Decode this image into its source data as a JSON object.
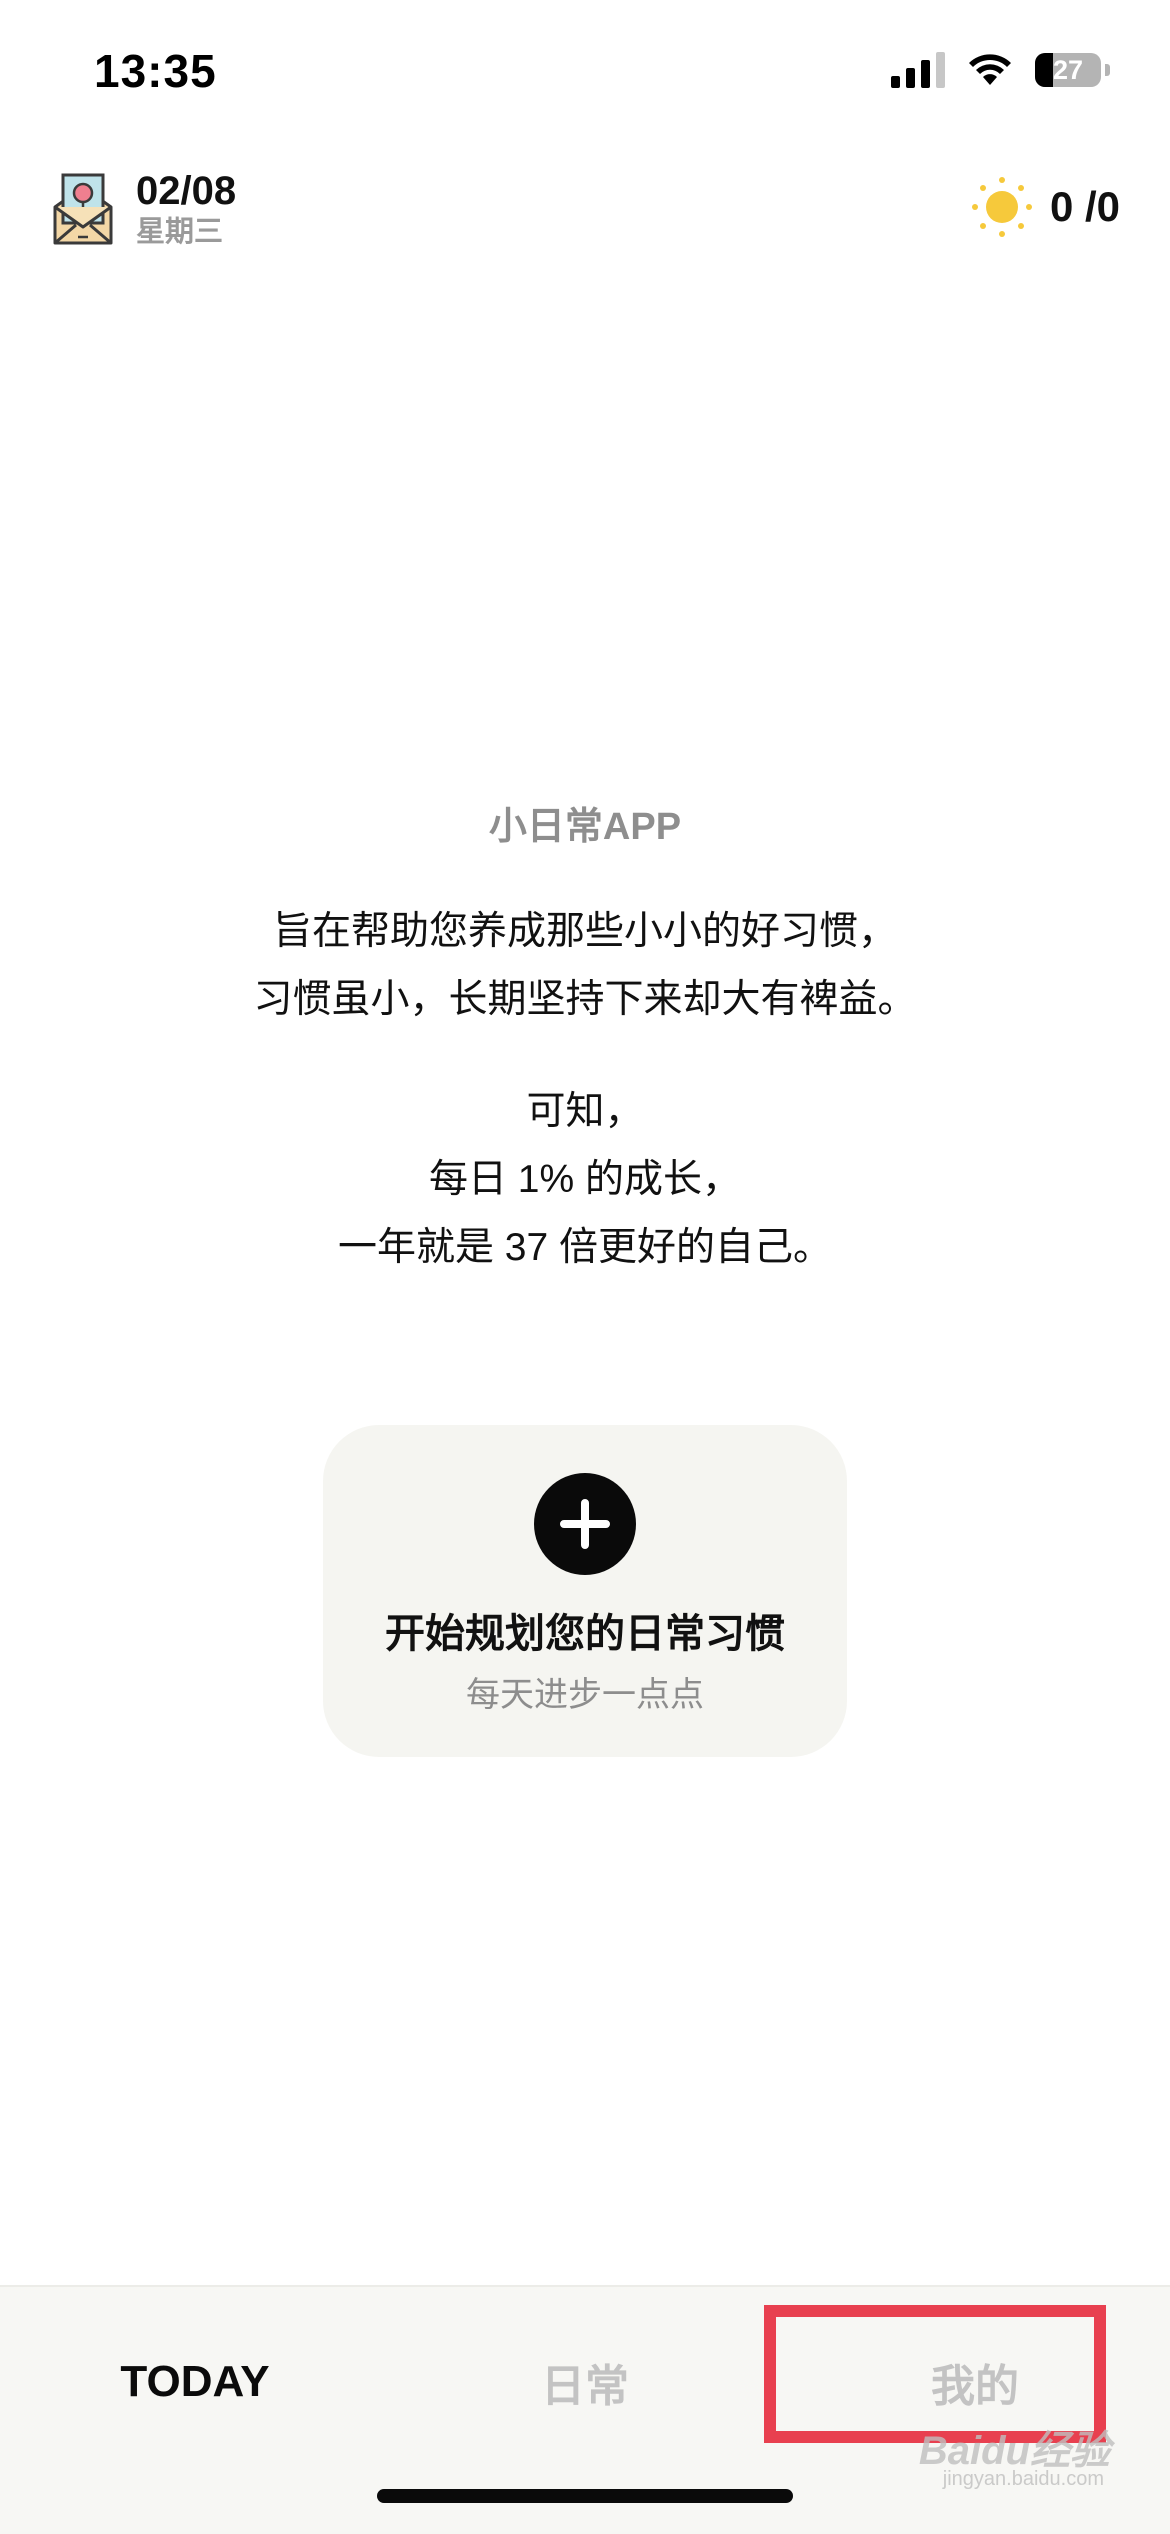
{
  "status_bar": {
    "time": "13:35",
    "battery": "27",
    "battery_level_percent": 27,
    "signal_bars_active": 3,
    "signal_bars_total": 4
  },
  "header": {
    "date": "02/08",
    "weekday": "星期三",
    "left_icon": "envelope-balloon-icon",
    "right_icon": "sun-icon",
    "score": "0 /0"
  },
  "intro": {
    "title": "小日常APP",
    "lines1": [
      "旨在帮助您养成那些小小的好习惯，",
      "习惯虽小，长期坚持下来却大有裨益。"
    ],
    "lines2": [
      "可知，",
      "每日 1% 的成长，",
      "一年就是 37 倍更好的自己。"
    ]
  },
  "card": {
    "icon": "plus-icon",
    "title": "开始规划您的日常习惯",
    "subtitle": "每天进步一点点"
  },
  "tabs": [
    {
      "label": "TODAY",
      "active": true
    },
    {
      "label": "日常",
      "active": false
    },
    {
      "label": "我的",
      "active": false
    }
  ],
  "watermark": {
    "text": "Baidu经验",
    "sub": "jingyan.baidu.com"
  },
  "colors": {
    "highlight": "#e8404f",
    "card_bg": "#f5f5f1",
    "tab_inactive": "#c3c3c3",
    "sun": "#f6c93b"
  }
}
